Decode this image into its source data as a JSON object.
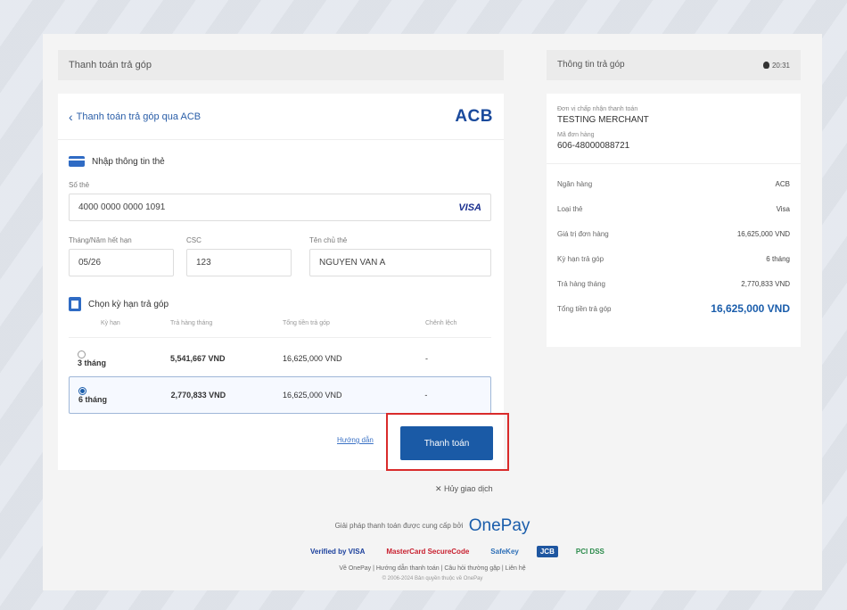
{
  "left_panel": {
    "header": "Thanh toán trả góp",
    "back_link": "Thanh toán trả góp qua ACB",
    "bank_logo": "ACB",
    "card_section_title": "Nhập thông tin thẻ",
    "card_number_label": "Số thẻ",
    "card_number_value": "4000 0000 0000 1091",
    "card_brand": "VISA",
    "expiry_label": "Tháng/Năm hết hạn",
    "expiry_value": "05/26",
    "cvv_label": "CSC",
    "cvv_value": "123",
    "holder_label": "Tên chủ thẻ",
    "holder_value": "NGUYEN VAN A",
    "term_section_title": "Chọn kỳ hạn trả góp",
    "table_headers": [
      "Kỳ hạn",
      "Trả hàng tháng",
      "Tổng tiền trả góp",
      "Chênh lệch"
    ],
    "rows": [
      {
        "term": "3 tháng",
        "monthly": "5,541,667 VND",
        "total": "16,625,000 VND",
        "diff": "-",
        "selected": false
      },
      {
        "term": "6 tháng",
        "monthly": "2,770,833 VND",
        "total": "16,625,000 VND",
        "diff": "-",
        "selected": true
      }
    ],
    "guide_link": "Hướng dẫn",
    "pay_button": "Thanh toán"
  },
  "cancel_link": "✕ Hủy giao dịch",
  "footer": {
    "provider_text": "Giải pháp thanh toán được cung cấp bởi",
    "provider_brand": "OnePay",
    "links": "Về OnePay | Hướng dẫn thanh toán | Câu hỏi thường gặp | Liên hệ",
    "copyright": "© 2006-2024 Bản quyền thuộc về OnePay",
    "brands": [
      "Verified by VISA",
      "MasterCard SecureCode",
      "SafeKey",
      "JCB",
      "PCI DSS"
    ]
  },
  "right_panel": {
    "header": "Thông tin trả góp",
    "timer": "20:31",
    "merchant_label": "Đơn vị chấp nhận thanh toán",
    "merchant_value": "TESTING MERCHANT",
    "order_label": "Mã đơn hàng",
    "order_value": "606-48000088721",
    "details": [
      {
        "label": "Ngân hàng",
        "value": "ACB"
      },
      {
        "label": "Loại thẻ",
        "value": "Visa"
      },
      {
        "label": "Giá trị đơn hàng",
        "value": "16,625,000 VND"
      },
      {
        "label": "Kỳ hạn trả góp",
        "value": "6 tháng"
      },
      {
        "label": "Trả hàng tháng",
        "value": "2,770,833 VND"
      },
      {
        "label": "Tổng tiền trả góp",
        "value": "16,625,000 VND"
      }
    ]
  },
  "colors": {
    "accent": "#1a5aa6",
    "highlight_box": "#d92b2b",
    "bank_logo": "#1a4a9c"
  }
}
